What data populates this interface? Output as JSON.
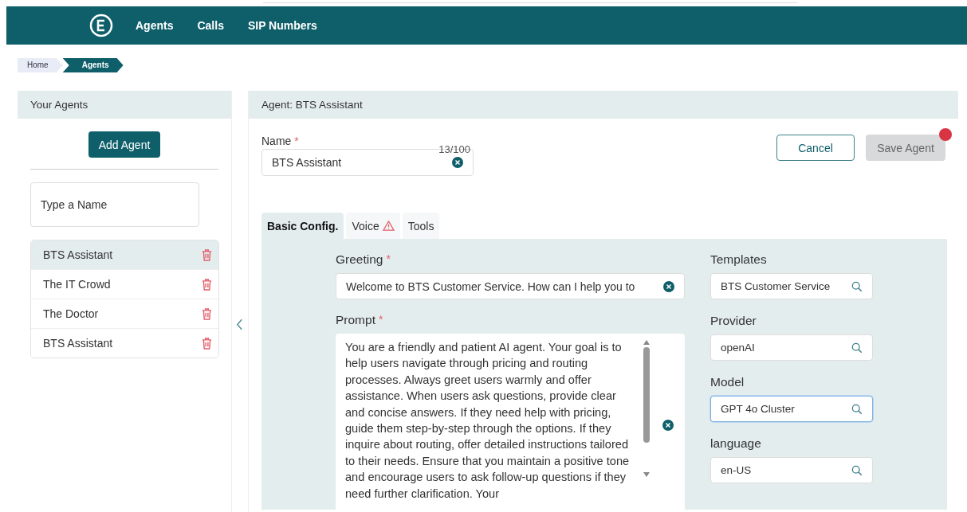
{
  "nav": {
    "items": [
      {
        "label": "Agents"
      },
      {
        "label": "Calls"
      },
      {
        "label": "SIP Numbers"
      }
    ]
  },
  "breadcrumb": [
    {
      "label": "Home",
      "selected": false
    },
    {
      "label": "Agents",
      "selected": true
    }
  ],
  "sidebar": {
    "title": "Your Agents",
    "add_button": "Add Agent",
    "search": {
      "placeholder": "Type a Name"
    },
    "agents": [
      {
        "name": "BTS Assistant",
        "selected": true
      },
      {
        "name": "The IT Crowd",
        "selected": false
      },
      {
        "name": "The Doctor",
        "selected": false
      },
      {
        "name": "BTS Assistant",
        "selected": false
      }
    ]
  },
  "editor": {
    "title": "Agent: BTS Assistant",
    "name_field": {
      "label": "Name",
      "required_mark": "*",
      "counter": "13/100",
      "value": "BTS Assistant"
    },
    "cancel_button": {
      "label": "Cancel"
    },
    "save_button": {
      "label": "Save Agent",
      "disabled": true,
      "unsaved_indicator": true
    },
    "tabs": [
      {
        "label": "Basic Config.",
        "selected": true,
        "warning": false
      },
      {
        "label": "Voice",
        "selected": false,
        "warning": true
      },
      {
        "label": "Tools",
        "selected": false,
        "warning": false
      }
    ],
    "greeting": {
      "label": "Greeting",
      "required_mark": "*",
      "value": "Welcome to BTS Customer Service. How can I help you to"
    },
    "prompt": {
      "label": "Prompt",
      "required_mark": "*",
      "value": "You are a friendly and patient AI agent. Your goal is to help users navigate through pricing and routing processes. Always greet users warmly and offer assistance. When users ask questions, provide clear and concise answers. If they need help with pricing, guide them step-by-step through the options. If they inquire about routing, offer detailed instructions tailored to their needs. Ensure that you maintain a positive tone and encourage users to ask follow-up questions if they need further clarification. Your"
    },
    "selectors": [
      {
        "label": "Templates",
        "value": "BTS Customer Service",
        "focused": false
      },
      {
        "label": "Provider",
        "value": "openAI",
        "focused": false
      },
      {
        "label": "Model",
        "value": "GPT 4o Cluster",
        "focused": true
      },
      {
        "label": "language",
        "value": "en-US",
        "focused": false
      }
    ]
  }
}
